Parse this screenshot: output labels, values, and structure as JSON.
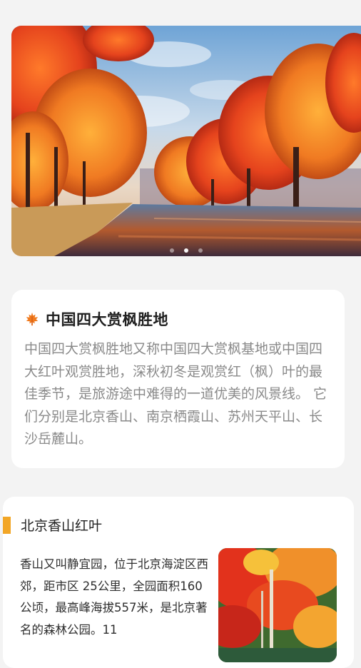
{
  "banner": {
    "image": "autumn-red-maple-lake",
    "pages": 3,
    "active_page": 2
  },
  "intro": {
    "icon": "maple-leaf-icon",
    "title": "中国四大赏枫胜地",
    "text": "中国四大赏枫胜地又称中国四大赏枫基地或中国四大红叶观赏胜地，深秋初冬是观赏红（枫）叶的最佳季节，是旅游途中难得的一道优美的风景线。 它们分别是北京香山、南京栖霞山、苏州天平山、长沙岳麓山。"
  },
  "section": {
    "title": "北京香山红叶",
    "text": "香山又叫静宜园，位于北京海淀区西郊，距市区 25公里，全园面积160公顷，最高峰海拔557米，是北京著名的森林公园。11",
    "image": "xiangshan-red-leaves"
  },
  "colors": {
    "background": "#f3f3f3",
    "accent_bar": "#f2a626",
    "muted_text": "#8a8a8a"
  }
}
